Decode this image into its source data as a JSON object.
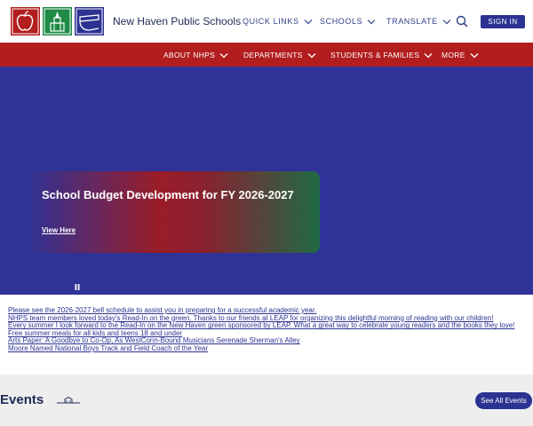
{
  "header": {
    "site_name": "New Haven Public Schools",
    "utility_links": [
      {
        "label": "QUICK LINKS"
      },
      {
        "label": "SCHOOLS"
      },
      {
        "label": "TRANSLATE"
      }
    ],
    "signin_label": "SIGN IN",
    "icons": [
      "apple-logo-icon",
      "building-logo-icon",
      "book-logo-icon",
      "search-icon",
      "chevron-down-icon"
    ]
  },
  "nav": {
    "items": [
      {
        "label": "ABOUT NHPS"
      },
      {
        "label": "DEPARTMENTS"
      },
      {
        "label": "STUDENTS & FAMILIES"
      },
      {
        "label": "MORE"
      }
    ]
  },
  "hero": {
    "title": "School Budget Development for FY 2026-2027",
    "link_label": "View Here",
    "pause_icon": "pause-icon"
  },
  "news": [
    "Please see the 2026-2027 bell schedule to assist you in preparing for a successful academic year.",
    "NHPS team members loved today's Read-In on the green. Thanks to our friends at LEAP for organizing this delightful morning of reading with our children!",
    "Every summer I look forward to the Read-In on the New Haven green sponsored by LEAP. What a great way to celebrate young readers and the books they love!",
    "Free summer meals for all kids and teens 18 and under",
    "Arts Paper: A Goodbye to Co-Op, As WestConn-Bound Musicians Serenade Sherman's Alley",
    "Moore Named National Boys Track and Field Coach of the Year"
  ],
  "events": {
    "title": "Events",
    "see_all_label": "See All Events"
  },
  "colors": {
    "brand_blue": "#2b3291",
    "brand_red": "#b21e1e",
    "hero_bg": "#2f3296",
    "gray_bg": "#eeeeee"
  }
}
